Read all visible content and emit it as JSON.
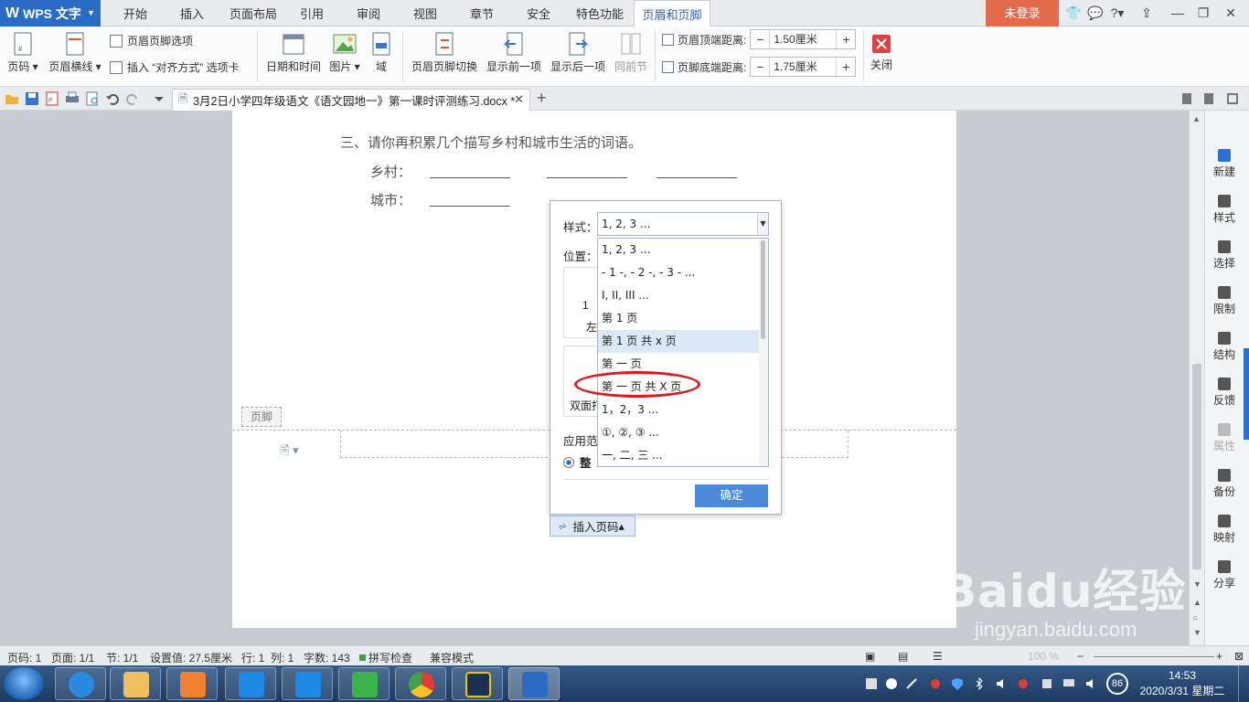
{
  "app": {
    "title": "WPS 文字"
  },
  "menu": {
    "tabs": [
      "开始",
      "插入",
      "页面布局",
      "引用",
      "审阅",
      "视图",
      "章节",
      "安全",
      "特色功能",
      "页眉和页脚"
    ],
    "login": "未登录"
  },
  "ribbon": {
    "page_number": "页码",
    "header_line": "页眉横线",
    "hf_options": "页眉页脚选项",
    "insert_align_tab": "插入 “对齐方式” 选项卡",
    "date_time": "日期和时间",
    "picture": "图片",
    "field": "域",
    "hf_switch": "页眉页脚切换",
    "show_prev": "显示前一项",
    "show_next": "显示后一项",
    "same_as_prev": "同前节",
    "header_top_label": "页眉顶端距离:",
    "header_top_value": "1.50厘米",
    "footer_bottom_label": "页脚底端距离:",
    "footer_bottom_value": "1.75厘米",
    "close": "关闭"
  },
  "doc_tab": {
    "name": "3月2日小学四年级语文《语文园地一》第一课时评测练习.docx *"
  },
  "document": {
    "question": "三、请你再积累几个描写乡村和城市生活的词语。",
    "rural_label": "乡村：",
    "city_label": "城市：",
    "footer_tag": "页脚"
  },
  "dialog": {
    "style_label": "样式：",
    "style_value": "1, 2, 3 ...",
    "position_label": "位置：",
    "pos_left_num": "1",
    "pos_left_label": "左",
    "double_sided": "双面打",
    "apply_label": "应用范",
    "apply_radio": "整",
    "ok": "确定",
    "options": [
      "1, 2, 3 ...",
      "- 1 -, - 2 -, - 3 - ...",
      "I, II, III ...",
      "第 1 页",
      "第 1 页 共 x 页",
      "第 一 页",
      "第 一 页 共 X 页",
      "1，2，3 ...",
      "①, ②, ③ ...",
      "一, 二, 三 ..."
    ],
    "highlighted_index": 4,
    "circled_index": 6
  },
  "insert_page_number": "插入页码",
  "right_panel": [
    "新建",
    "样式",
    "选择",
    "限制",
    "结构",
    "反馈",
    "属性",
    "备份",
    "映射",
    "分享"
  ],
  "status": {
    "page_code": "页码: 1",
    "page": "页面: 1/1",
    "section": "节: 1/1",
    "setting": "设置值: 27.5厘米",
    "row": "行: 1",
    "col": "列: 1",
    "word_count": "字数: 143",
    "spell_check": "拼写检查",
    "compat": "兼容模式",
    "zoom": "100 %"
  },
  "taskbar": {
    "time": "14:53",
    "date": "2020/3/31 星期二",
    "badge": "86"
  },
  "watermark": {
    "text": "Baidu经验",
    "url": "jingyan.baidu.com"
  },
  "colors": {
    "accent": "#2a6cc4",
    "login": "#e46a4c",
    "ok": "#4a8ad8",
    "highlight": "#dce8f8",
    "circle": "#e0181d"
  }
}
